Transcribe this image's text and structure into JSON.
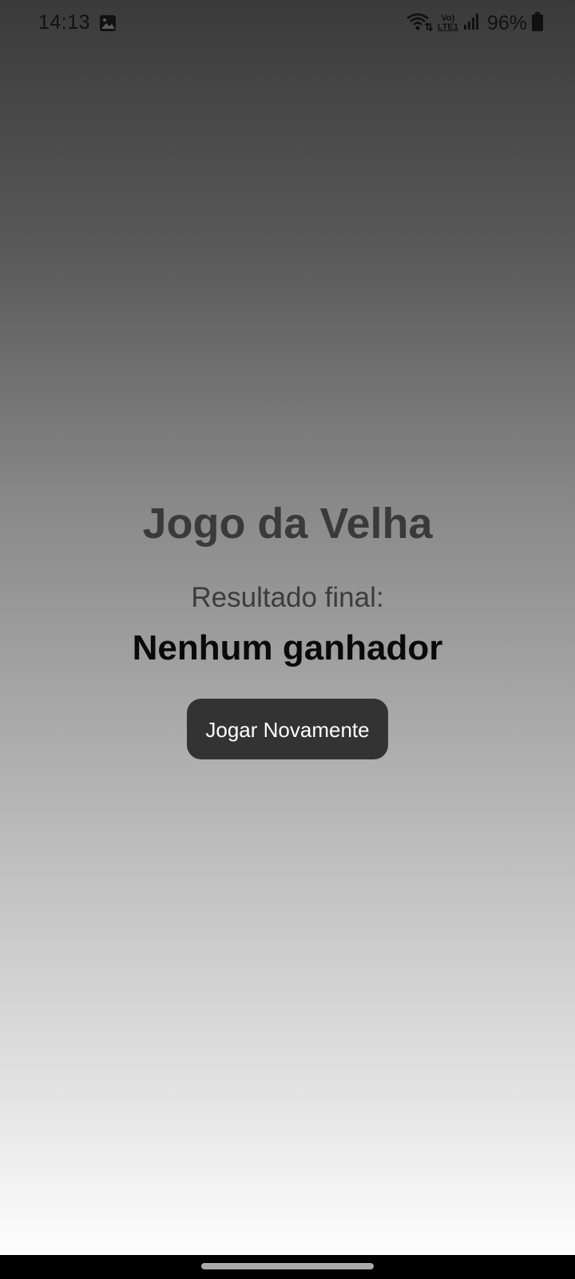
{
  "status_bar": {
    "time": "14:13",
    "image_icon": "image-icon",
    "wifi_icon": "wifi-icon",
    "volte_label_top": "Vo)",
    "volte_label_bottom": "LTE1",
    "signal_icon": "signal-icon",
    "battery_percent": "96%",
    "battery_icon": "battery-icon"
  },
  "main": {
    "title": "Jogo da Velha",
    "result_label": "Resultado final:",
    "result_value": "Nenhum ganhador",
    "play_again_label": "Jogar Novamente"
  },
  "navigation": {
    "home_indicator": "home-indicator"
  },
  "colors": {
    "background_top": "#3a3a3a",
    "background_bottom": "#ffffff",
    "title": "#3a3a3a",
    "button_bg": "#333333",
    "button_text": "#ffffff"
  }
}
